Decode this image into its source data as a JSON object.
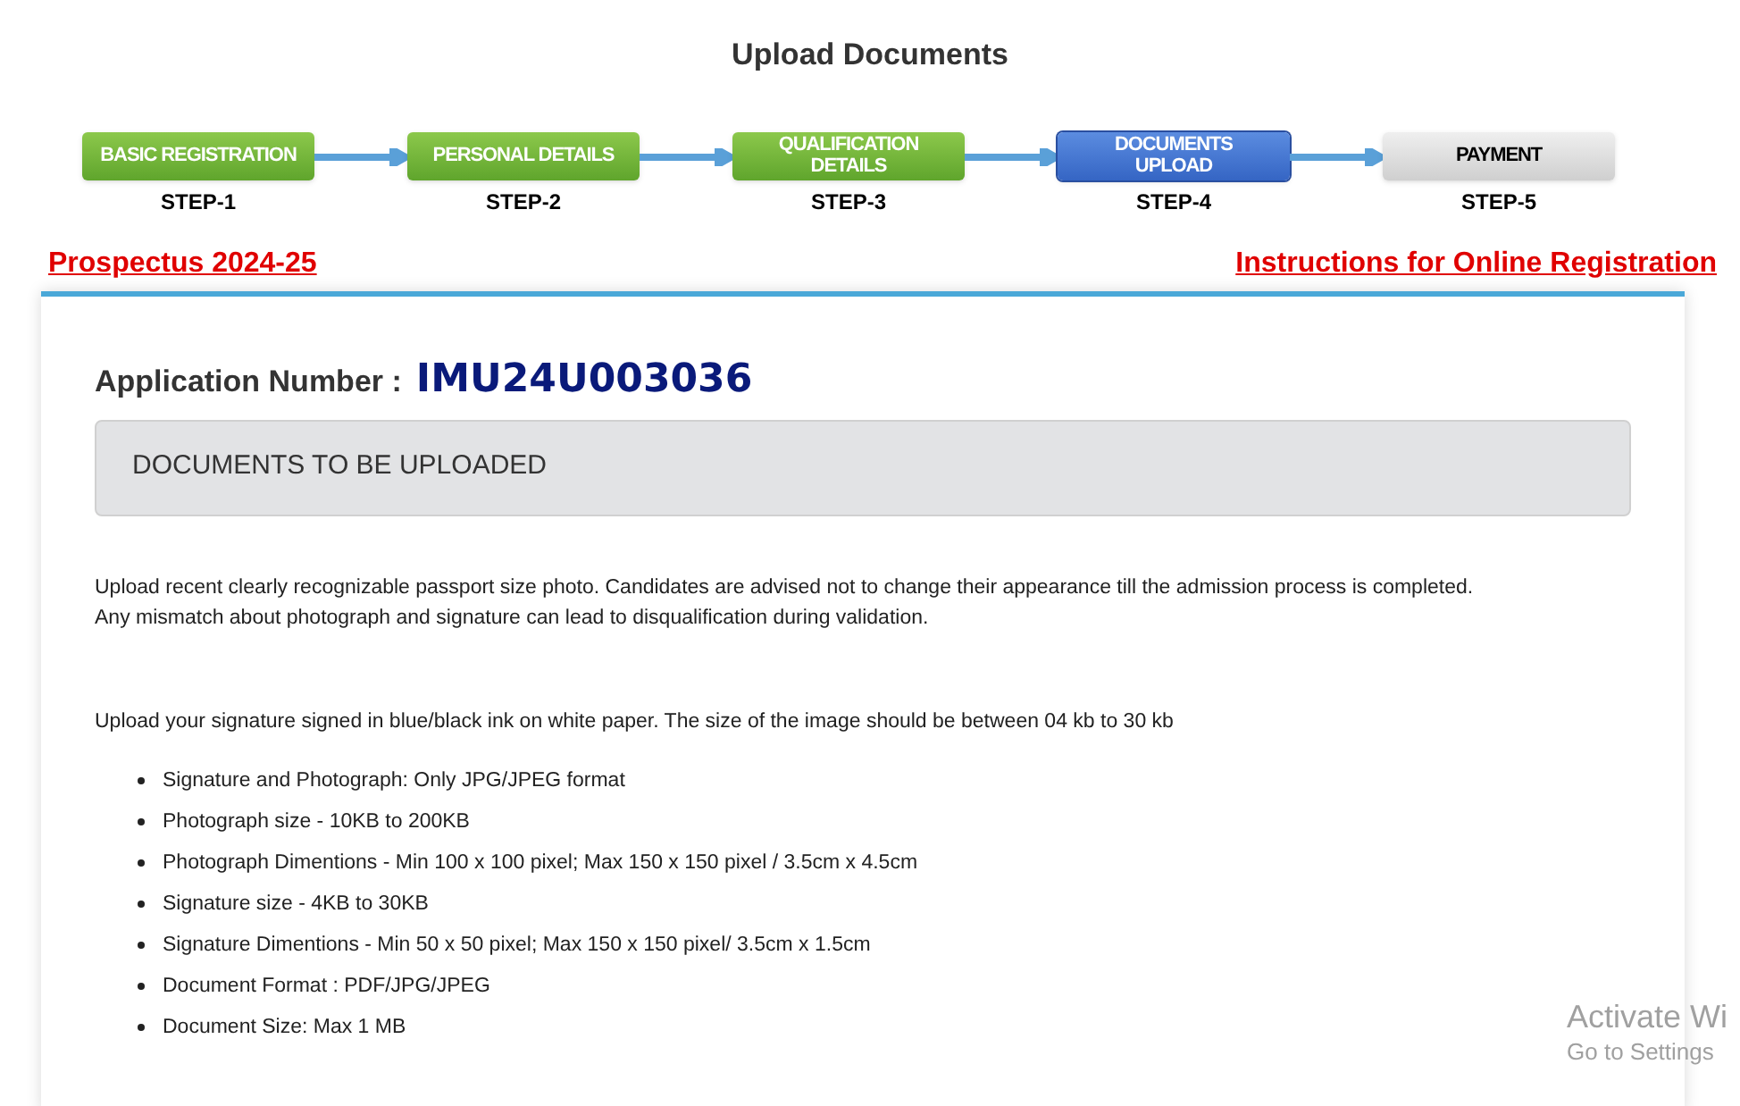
{
  "page_title": "Upload Documents",
  "steps": [
    {
      "label": "BASIC REGISTRATION",
      "step": "STEP-1",
      "kind": "done",
      "selected": false
    },
    {
      "label": "PERSONAL DETAILS",
      "step": "STEP-2",
      "kind": "done",
      "selected": false
    },
    {
      "label": "QUALIFICATION DETAILS",
      "step": "STEP-3",
      "kind": "done",
      "selected": false
    },
    {
      "label": "DOCUMENTS UPLOAD",
      "step": "STEP-4",
      "kind": "current",
      "selected": true
    },
    {
      "label": "PAYMENT",
      "step": "STEP-5",
      "kind": "pending",
      "selected": false
    }
  ],
  "links": [
    "Prospectus 2024-25",
    "Instructions for Online Registration"
  ],
  "application": {
    "label": "Application Number :",
    "number": "IMU24U003036"
  },
  "section_heading": "DOCUMENTS TO BE UPLOADED",
  "photo_note": [
    "Upload recent clearly recognizable passport size photo. Candidates are advised not to change their appearance till the admission process is completed.",
    "Any mismatch about photograph and signature can lead to disqualification during validation."
  ],
  "signature_note": "Upload your signature signed in blue/black ink on white paper. The size of the image should be between 04 kb to 30 kb",
  "requirements": [
    "Signature and Photograph: Only JPG/JPEG format",
    "Photograph size - 10KB to 200KB",
    "Photograph Dimentions - Min 100 x 100 pixel; Max 150 x 150 pixel / 3.5cm x 4.5cm",
    "Signature size - 4KB to 30KB",
    "Signature Dimentions - Min 50 x 50 pixel; Max 150 x 150 pixel/ 3.5cm x 1.5cm",
    "Document Format : PDF/JPG/JPEG",
    "Document Size: Max 1 MB"
  ],
  "os_overlay": [
    "Activate Wi",
    "Go to Settings"
  ]
}
